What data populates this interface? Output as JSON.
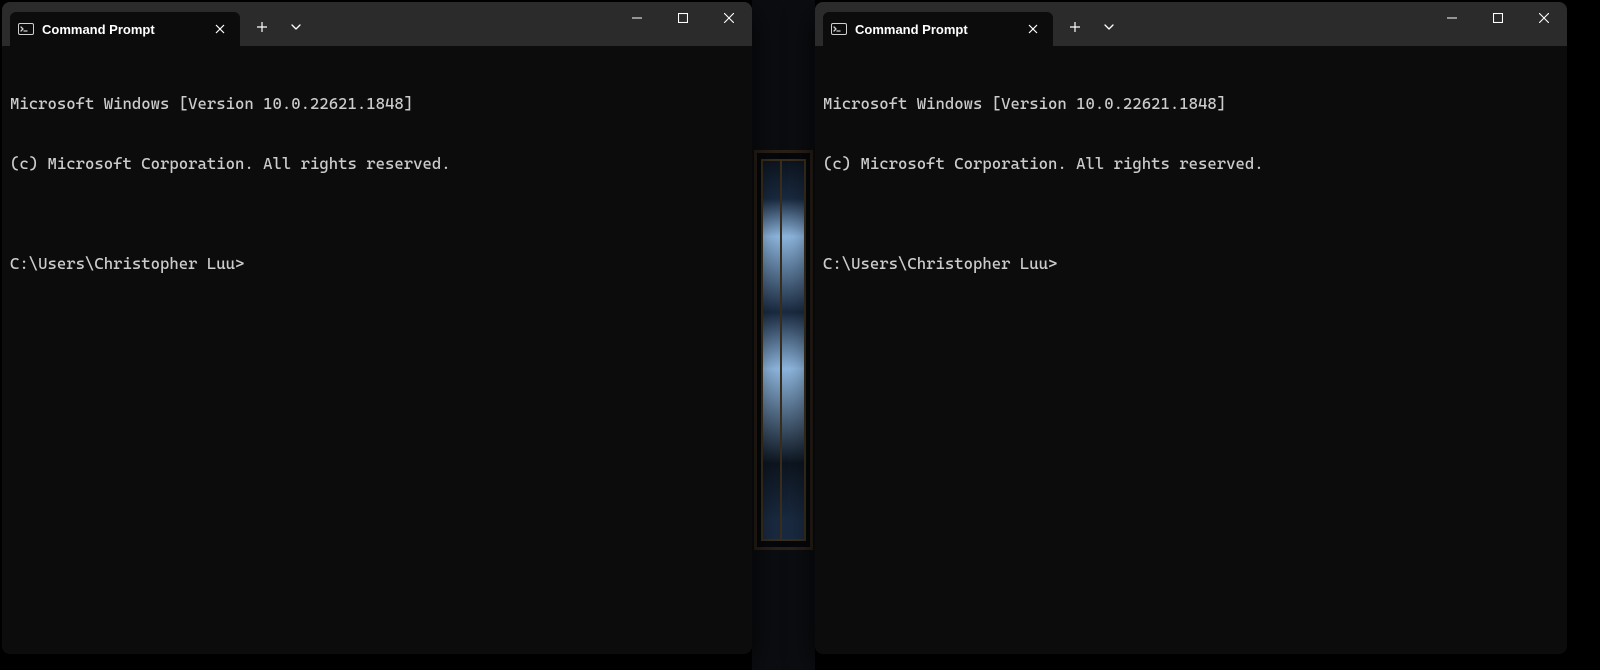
{
  "windows": {
    "left": {
      "tab_title": "Command Prompt",
      "lines": [
        "Microsoft Windows [Version 10.0.22621.1848]",
        "(c) Microsoft Corporation. All rights reserved.",
        "",
        "C:\\Users\\Christopher Luu>"
      ]
    },
    "right": {
      "tab_title": "Command Prompt",
      "lines": [
        "Microsoft Windows [Version 10.0.22621.1848]",
        "(c) Microsoft Corporation. All rights reserved.",
        "",
        "C:\\Users\\Christopher Luu>"
      ]
    }
  },
  "icons": {
    "app": "cmd-icon",
    "tab_close": "close-icon",
    "new_tab": "plus-icon",
    "tab_menu": "chevron-down-icon",
    "minimize": "minimize-icon",
    "maximize": "maximize-icon",
    "close": "close-icon"
  },
  "colors": {
    "titlebar": "#2b2b2b",
    "tab_bg": "#0c0c0c",
    "terminal_bg": "#0c0c0c",
    "terminal_fg": "#cccccc"
  }
}
